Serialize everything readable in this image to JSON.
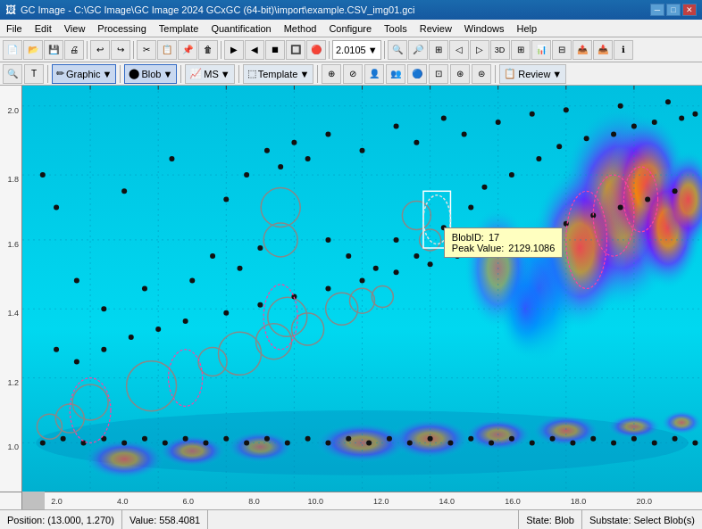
{
  "titlebar": {
    "title": "GC Image - C:\\GC Image\\GC Image 2024 GCxGC (64-bit)\\import\\example.CSV_img01.gci",
    "icon": "gc-image-icon",
    "min_label": "─",
    "max_label": "□",
    "close_label": "✕"
  },
  "menubar": {
    "items": [
      "File",
      "Edit",
      "View",
      "Processing",
      "Template",
      "Quantification",
      "Method",
      "Configure",
      "Tools",
      "Review",
      "Windows",
      "Help"
    ]
  },
  "toolbar1": {
    "buttons": [
      "new",
      "open",
      "save",
      "print",
      "sep",
      "undo",
      "redo",
      "sep",
      "cut",
      "copy",
      "paste",
      "delete",
      "sep",
      "b1",
      "b2",
      "b3",
      "b4",
      "b5",
      "b6",
      "b7",
      "b8",
      "sep",
      "zoom_val",
      "sep",
      "b9",
      "b10",
      "b11",
      "b12",
      "b13",
      "b14",
      "b15",
      "b16",
      "b17",
      "b18",
      "b19",
      "b20"
    ],
    "zoom_value": "2.0105"
  },
  "toolbar2": {
    "search_icon": "🔍",
    "text_tool": "T",
    "graphic_label": "Graphic",
    "blob_label": "Blob",
    "ms_label": "MS",
    "template_label": "Template",
    "review_label": "Review",
    "groups": [
      "Graphic",
      "Blob",
      "MS",
      "Template",
      "Review"
    ]
  },
  "plot": {
    "background_color": "#00c8e0",
    "xaxis_labels": [
      "2.0",
      "4.0",
      "6.0",
      "8.0",
      "10.0",
      "12.0",
      "14.0",
      "16.0",
      "18.0",
      "20.0"
    ],
    "yaxis_labels": [
      "1.0",
      "1.2",
      "1.4",
      "1.6",
      "1.8",
      "2.0"
    ],
    "tooltip": {
      "blob_id_label": "BlobID:",
      "blob_id_value": "17",
      "peak_label": "Peak Value:",
      "peak_value": "2129.1086"
    }
  },
  "statusbar": {
    "position_label": "Position:",
    "position_value": "(13.000, 1.270)",
    "value_label": "Value:",
    "value_value": "558.4081",
    "state_label": "State:",
    "state_value": "Blob",
    "substate_label": "Substate:",
    "substate_value": "Select Blob(s)"
  }
}
